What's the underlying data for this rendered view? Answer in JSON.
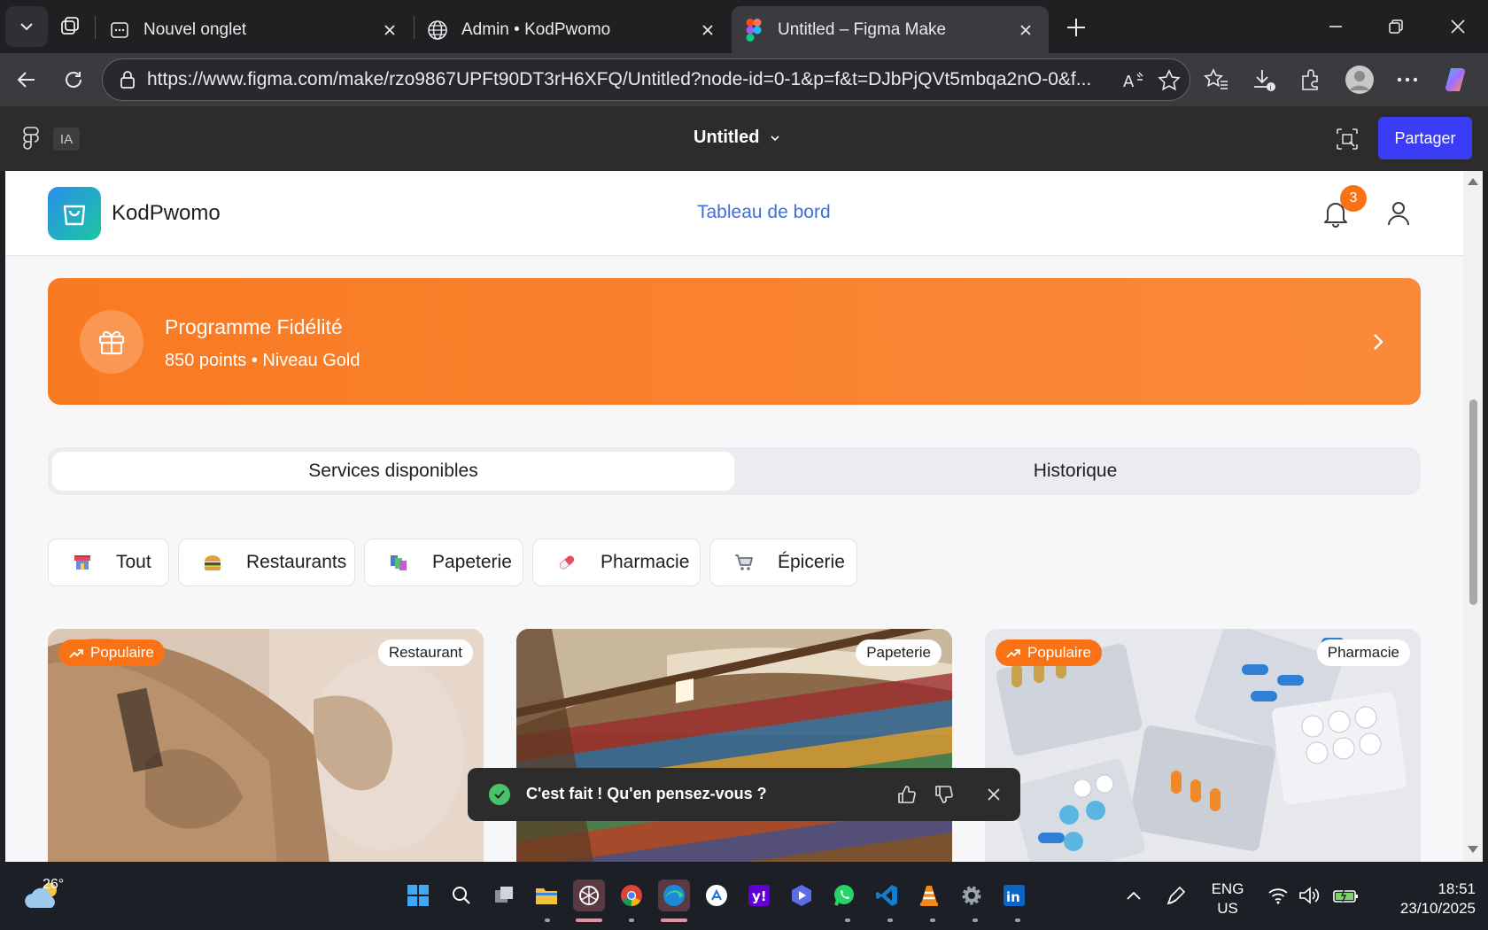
{
  "browser": {
    "tabs": [
      {
        "title": "Nouvel onglet",
        "active": false
      },
      {
        "title": "Admin • KodPwomo",
        "active": false
      },
      {
        "title": "Untitled – Figma Make",
        "active": true
      }
    ],
    "url": "https://www.figma.com/make/rzo9867UPFt90DT3rH6XFQ/Untitled?node-id=0-1&p=f&t=DJbPjQVt5mbqa2nO-0&f..."
  },
  "figma": {
    "ia_label": "IA",
    "file_title": "Untitled",
    "share_label": "Partager"
  },
  "app": {
    "brand": "KodPwomo",
    "nav_link": "Tableau de bord",
    "notification_count": "3",
    "loyalty": {
      "title": "Programme Fidélité",
      "subtitle": "850 points • Niveau Gold"
    },
    "tabs": [
      {
        "label": "Services disponibles",
        "active": true
      },
      {
        "label": "Historique",
        "active": false
      }
    ],
    "filters": [
      {
        "label": "Tout",
        "icon": "store-icon"
      },
      {
        "label": "Restaurants",
        "icon": "burger-icon"
      },
      {
        "label": "Papeterie",
        "icon": "books-icon"
      },
      {
        "label": "Pharmacie",
        "icon": "pill-icon"
      },
      {
        "label": "Épicerie",
        "icon": "cart-icon"
      }
    ],
    "cards": [
      {
        "category": "Restaurant",
        "popular": "Populaire"
      },
      {
        "category": "Papeterie",
        "popular": ""
      },
      {
        "category": "Pharmacie",
        "popular": "Populaire"
      }
    ],
    "accent_color": "#f97316",
    "link_color": "#3b6fe0"
  },
  "toast": {
    "message": "C'est fait ! Qu'en pensez-vous ?"
  },
  "taskbar": {
    "temperature": "26°",
    "language": "ENG",
    "region": "US",
    "time": "18:51",
    "date": "23/10/2025"
  }
}
